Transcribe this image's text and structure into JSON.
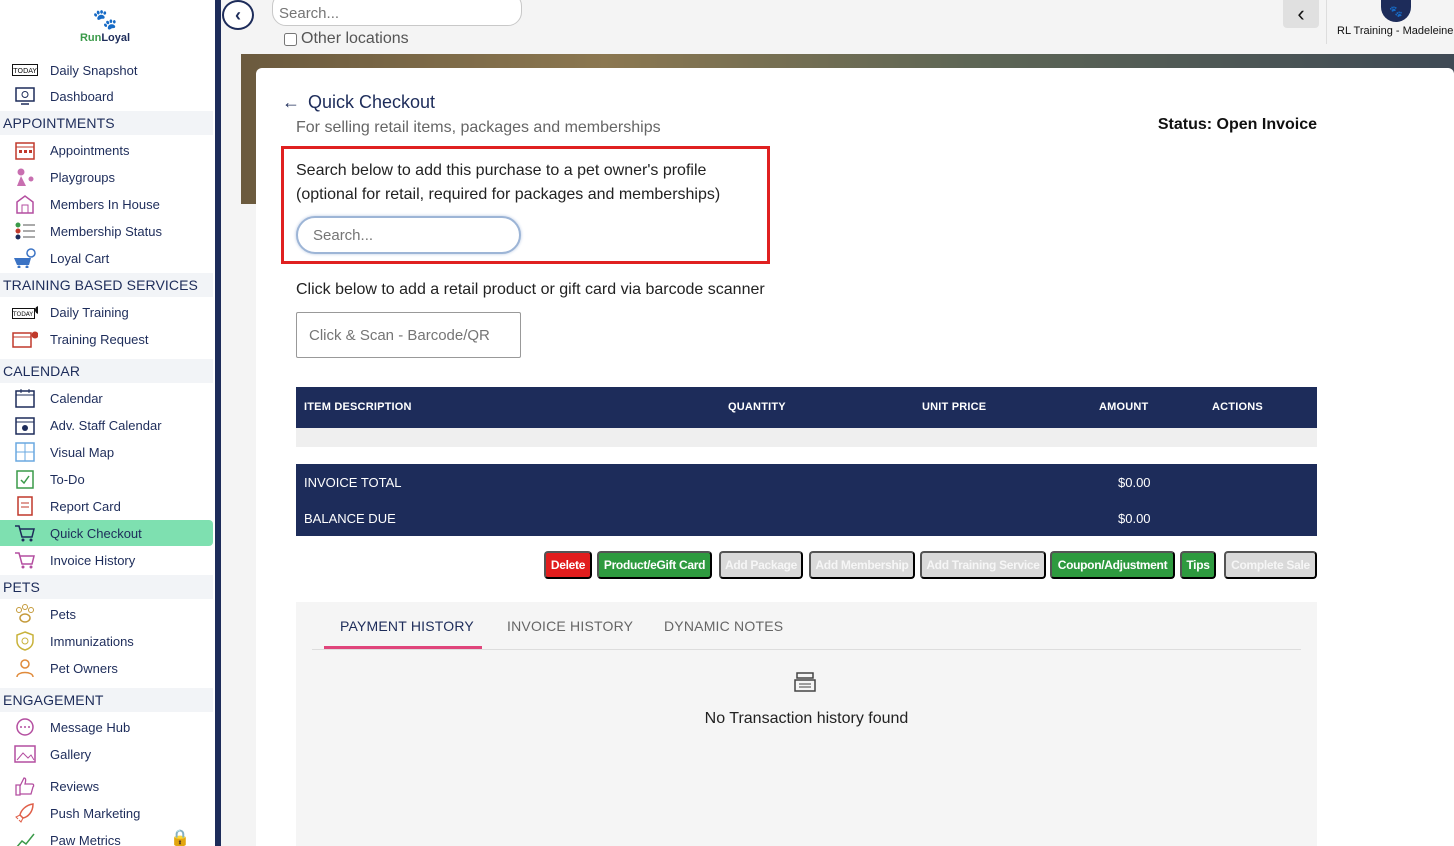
{
  "brand": {
    "name_a": "Run",
    "name_b": "Loyal"
  },
  "sidebar": {
    "items": [
      {
        "label": "Daily Snapshot",
        "icon": "today-icon"
      },
      {
        "label": "Dashboard",
        "icon": "dashboard-icon"
      },
      {
        "section": "APPOINTMENTS"
      },
      {
        "label": "Appointments",
        "icon": "calendar-grid-icon"
      },
      {
        "label": "Playgroups",
        "icon": "dogs-playing-icon"
      },
      {
        "label": "Members In House",
        "icon": "house-icon"
      },
      {
        "label": "Membership Status",
        "icon": "list-status-icon"
      },
      {
        "label": "Loyal Cart",
        "icon": "cart-icon"
      },
      {
        "section": "TRAINING BASED SERVICES"
      },
      {
        "label": "Daily Training",
        "icon": "today-whistle-icon"
      },
      {
        "label": "Training Request",
        "icon": "training-request-icon"
      },
      {
        "section": "CALENDAR"
      },
      {
        "label": "Calendar",
        "icon": "calendar-icon"
      },
      {
        "label": "Adv. Staff Calendar",
        "icon": "staff-calendar-icon"
      },
      {
        "label": "Visual Map",
        "icon": "map-grid-icon"
      },
      {
        "label": "To-Do",
        "icon": "todo-icon"
      },
      {
        "label": "Report Card",
        "icon": "report-card-icon"
      },
      {
        "label": "Quick Checkout",
        "icon": "checkout-cart-icon",
        "active": true
      },
      {
        "label": "Invoice History",
        "icon": "invoice-history-icon"
      },
      {
        "section": "PETS"
      },
      {
        "label": "Pets",
        "icon": "paw-icon"
      },
      {
        "label": "Immunizations",
        "icon": "shield-icon"
      },
      {
        "label": "Pet Owners",
        "icon": "person-icon"
      },
      {
        "section": "ENGAGEMENT"
      },
      {
        "label": "Message Hub",
        "icon": "chat-icon"
      },
      {
        "label": "Gallery",
        "icon": "gallery-icon"
      },
      {
        "label": "Reviews",
        "icon": "thumbs-up-icon"
      },
      {
        "label": "Push Marketing",
        "icon": "rocket-icon"
      },
      {
        "label": "Paw Metrics",
        "icon": "chart-icon"
      }
    ]
  },
  "topbar": {
    "search_placeholder": "Search...",
    "other_locations": "Other locations",
    "location_name": "RL Training - Madeleine"
  },
  "page": {
    "title": "Quick Checkout",
    "subtitle": "For selling retail items, packages and memberships",
    "status": "Status: Open Invoice",
    "owner_prompt": "Search below to add this purchase to a pet owner's profile (optional for retail, required for packages and memberships)",
    "owner_search_placeholder": "Search...",
    "barcode_prompt": "Click below to add a retail product or gift card via barcode scanner",
    "barcode_placeholder": "Click & Scan - Barcode/QR"
  },
  "table": {
    "columns": [
      "ITEM DESCRIPTION",
      "QUANTITY",
      "UNIT PRICE",
      "AMOUNT",
      "ACTIONS"
    ],
    "invoice_total_label": "INVOICE TOTAL",
    "invoice_total_value": "$0.00",
    "balance_due_label": "BALANCE DUE",
    "balance_due_value": "$0.00"
  },
  "actions": [
    {
      "label": "Delete",
      "style": "red"
    },
    {
      "label": "Product/eGift Card",
      "style": "green"
    },
    {
      "label": "Add Package",
      "style": "disabled"
    },
    {
      "label": "Add Membership",
      "style": "disabled"
    },
    {
      "label": "Add Training Service",
      "style": "disabled"
    },
    {
      "label": "Coupon/Adjustment",
      "style": "green"
    },
    {
      "label": "Tips",
      "style": "green"
    },
    {
      "label": "Complete Sale",
      "style": "disabled"
    }
  ],
  "tabs": [
    {
      "label": "PAYMENT HISTORY",
      "active": true
    },
    {
      "label": "INVOICE HISTORY"
    },
    {
      "label": "DYNAMIC NOTES"
    }
  ],
  "empty_state": {
    "icon": "cash-register-icon",
    "message": "No Transaction history found"
  },
  "colors": {
    "navy": "#1d2c5a",
    "active_green": "#7ee0b0",
    "action_green": "#2e9a3f",
    "danger": "#e11d1d",
    "tab_accent": "#e0457b"
  }
}
